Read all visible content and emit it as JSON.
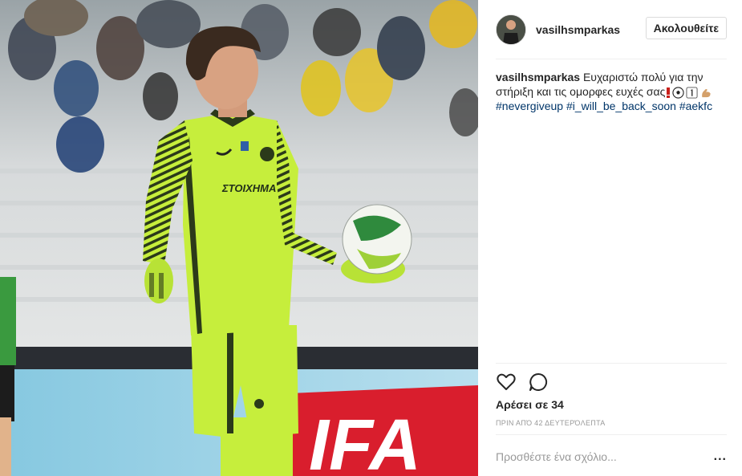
{
  "post": {
    "username": "vasilhsmparkas",
    "follow_label": "Ακολουθείτε",
    "caption": {
      "username": "vasilhsmparkas",
      "text": "Ευχαριστώ πολύ για την στήριξη και τις ομορφες ευχές σας",
      "emojis": [
        "exclamation-icon",
        "soccer-ball-icon",
        "number-one-icon",
        "flexed-biceps-icon"
      ],
      "hashtags": "#nevergiveup #i_will_be_back_soon #aekfc"
    },
    "likes_prefix": "Αρέσει σε",
    "likes_count": "34",
    "timestamp": "ΠΡΙΝ ΑΠΌ 42 ΔΕΥΤΕΡΌΛΕΠΤΑ",
    "comment_placeholder": "Προσθέστε ένα σχόλιο...",
    "more_label": "..."
  },
  "photo": {
    "jersey_sponsor": "ΣΤΟΙΧΗΜΑ",
    "banner_text": "IFA"
  },
  "colors": {
    "jersey": "#c6ee3c",
    "stripe": "#2b3a1a",
    "banner": "#d91e2d",
    "hashtag": "#003569"
  }
}
